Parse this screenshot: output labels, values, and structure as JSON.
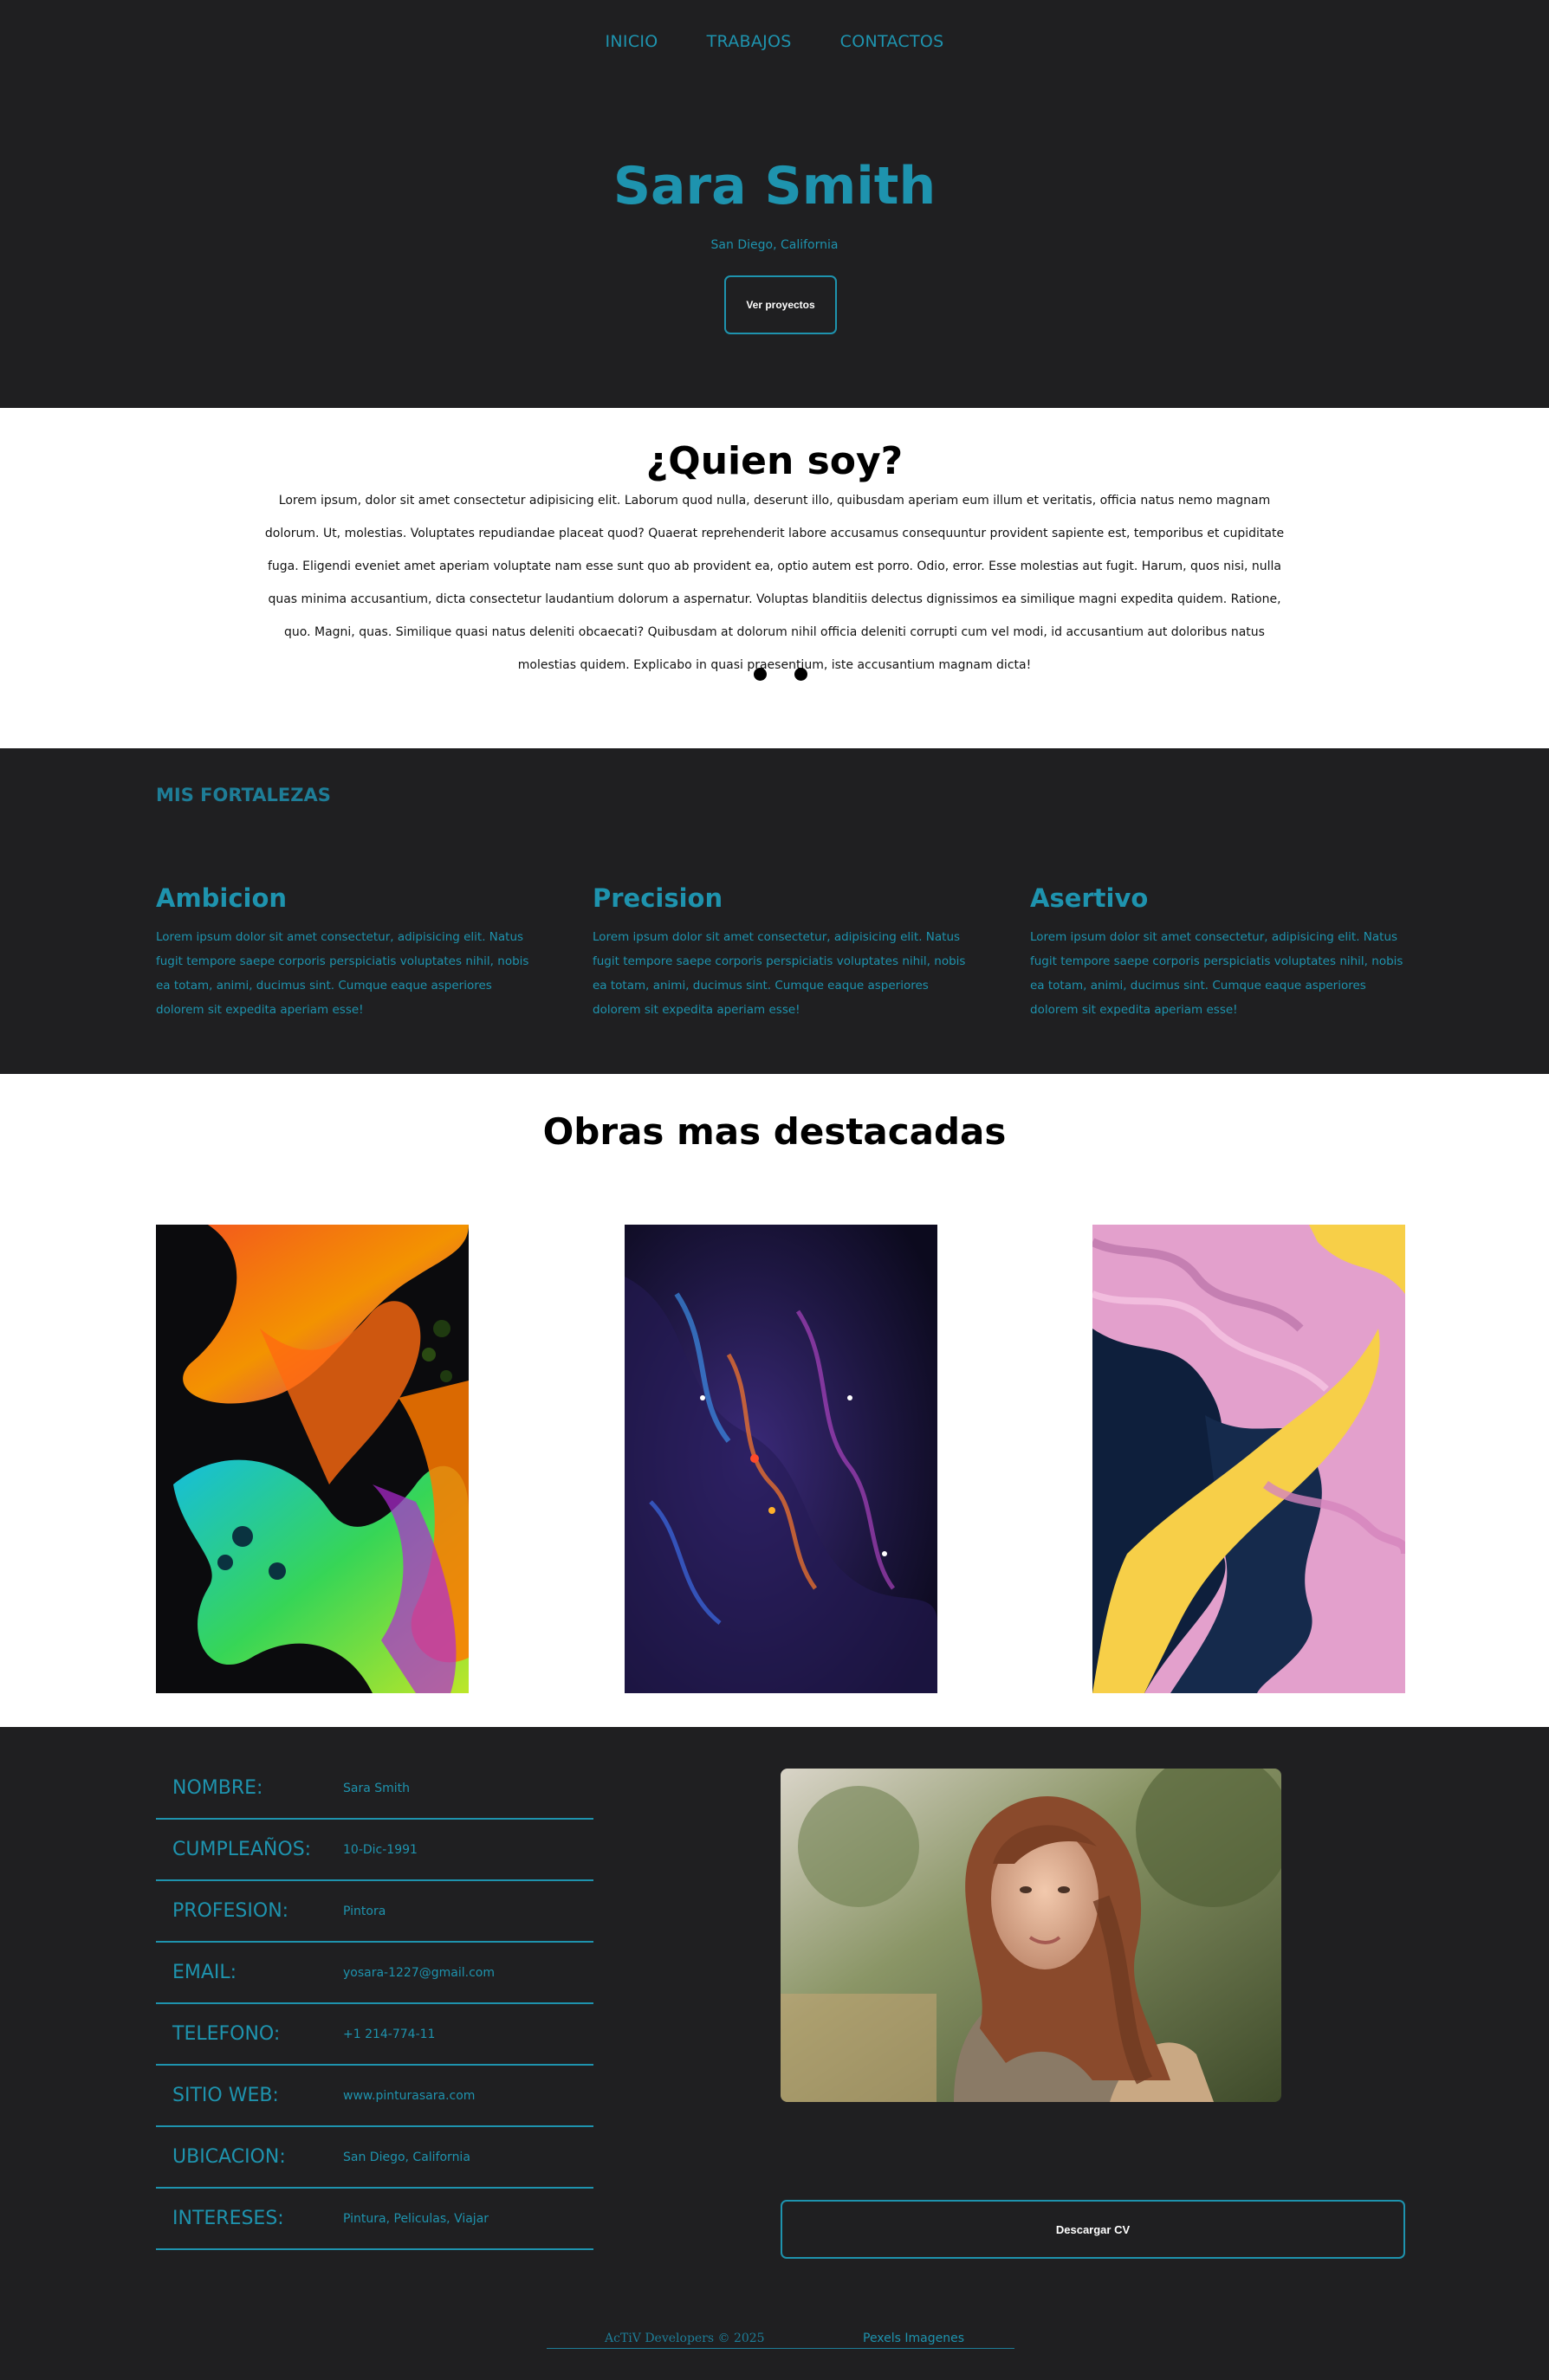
{
  "nav": {
    "items": [
      "INICIO",
      "TRABAJOS",
      "CONTACTOS"
    ]
  },
  "hero": {
    "name": "Sara Smith",
    "location": "San Diego, California",
    "button": "Ver proyectos"
  },
  "about": {
    "title": "¿Quien soy?",
    "text": "Lorem ipsum, dolor sit amet consectetur adipisicing elit. Laborum quod nulla, deserunt illo, quibusdam aperiam eum illum et veritatis, officia natus nemo magnam dolorum. Ut, molestias. Voluptates repudiandae placeat quod? Quaerat reprehenderit labore accusamus consequuntur provident sapiente est, temporibus et cupiditate fuga. Eligendi eveniet amet aperiam voluptate nam esse sunt quo ab provident ea, optio autem est porro. Odio, error. Esse molestias aut fugit. Harum, quos nisi, nulla quas minima accusantium, dicta consectetur laudantium dolorum a aspernatur. Voluptas blanditiis delectus dignissimos ea similique magni expedita quidem. Ratione, quo. Magni, quas. Similique quasi natus deleniti obcaecati? Quibusdam at dolorum nihil officia deleniti corrupti cum vel modi, id accusantium aut doloribus natus molestias quidem. Explicabo in quasi praesentium, iste accusantium magnam dicta!"
  },
  "strengths": {
    "heading": "MIS FORTALEZAS",
    "items": [
      {
        "title": "Ambicion",
        "text": "Lorem ipsum dolor sit amet consectetur, adipisicing elit. Natus fugit tempore saepe corporis perspiciatis voluptates nihil, nobis ea totam, animi, ducimus sint. Cumque eaque asperiores dolorem sit expedita aperiam esse!"
      },
      {
        "title": "Precision",
        "text": "Lorem ipsum dolor sit amet consectetur, adipisicing elit. Natus fugit tempore saepe corporis perspiciatis voluptates nihil, nobis ea totam, animi, ducimus sint. Cumque eaque asperiores dolorem sit expedita aperiam esse!"
      },
      {
        "title": "Asertivo",
        "text": "Lorem ipsum dolor sit amet consectetur, adipisicing elit. Natus fugit tempore saepe corporis perspiciatis voluptates nihil, nobis ea totam, animi, ducimus sint. Cumque eaque asperiores dolorem sit expedita aperiam esse!"
      }
    ]
  },
  "works": {
    "title": "Obras mas destacadas"
  },
  "info": {
    "rows": [
      {
        "key": "NOMBRE:",
        "value": "Sara Smith"
      },
      {
        "key": "CUMPLEAÑOS:",
        "value": "10-Dic-1991"
      },
      {
        "key": "PROFESION:",
        "value": "Pintora"
      },
      {
        "key": "EMAIL:",
        "value": "yosara-1227@gmail.com"
      },
      {
        "key": "TELEFONO:",
        "value": "+1 214-774-11"
      },
      {
        "key": "SITIO WEB:",
        "value": "www.pinturasara.com"
      },
      {
        "key": "UBICACION:",
        "value": "San Diego, California"
      },
      {
        "key": "INTERESES:",
        "value": "Pintura, Peliculas, Viajar"
      }
    ],
    "cv_button": "Descargar CV"
  },
  "footer": {
    "copyright": "AcTiV Developers © 2025",
    "link": "Pexels Imagenes"
  },
  "colors": {
    "accent": "#1e93ae",
    "background": "#1f1f21",
    "light": "#ffffff"
  }
}
